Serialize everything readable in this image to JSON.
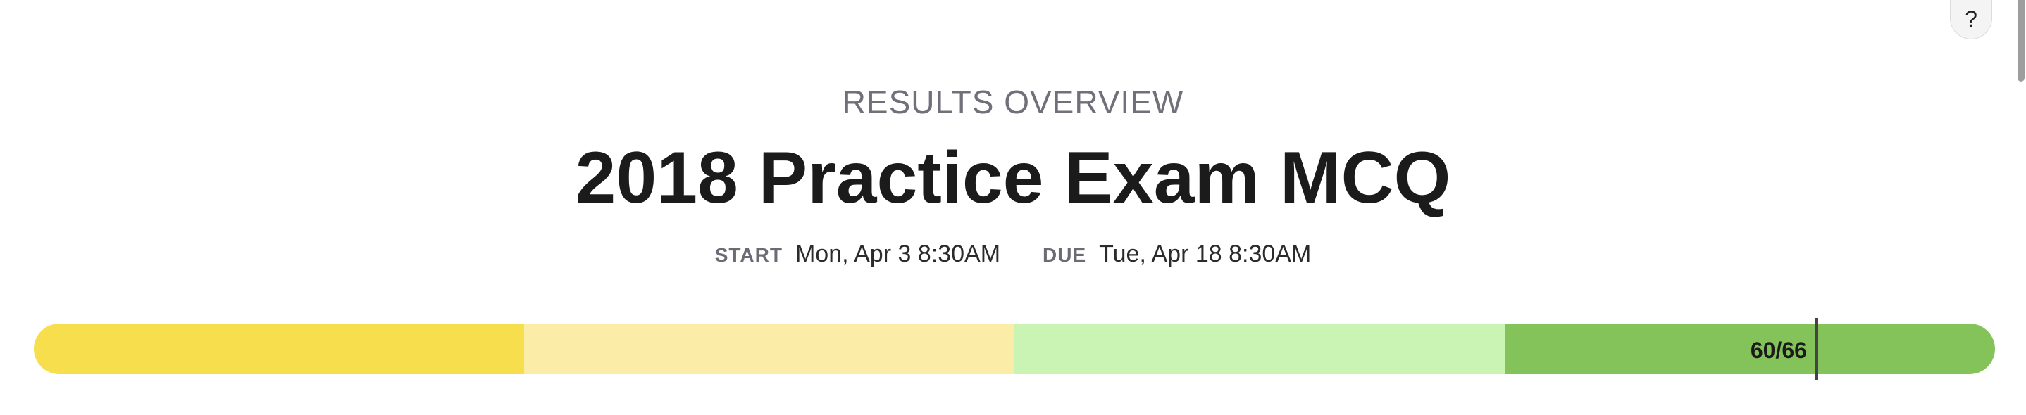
{
  "help": {
    "label": "?"
  },
  "header": {
    "overview_label": "RESULTS OVERVIEW",
    "title": "2018 Practice Exam MCQ"
  },
  "dates": {
    "start_key": "START",
    "start_value": "Mon, Apr 3 8:30AM",
    "due_key": "DUE",
    "due_value": "Tue, Apr 18 8:30AM"
  },
  "score": {
    "earned": 60,
    "total": 66,
    "label": "60/66",
    "segments": [
      {
        "name": "low",
        "color": "#f7de4c"
      },
      {
        "name": "mid-low",
        "color": "#fbeca7"
      },
      {
        "name": "mid-high",
        "color": "#c9f4b4"
      },
      {
        "name": "high",
        "color": "#84c25a"
      }
    ]
  }
}
